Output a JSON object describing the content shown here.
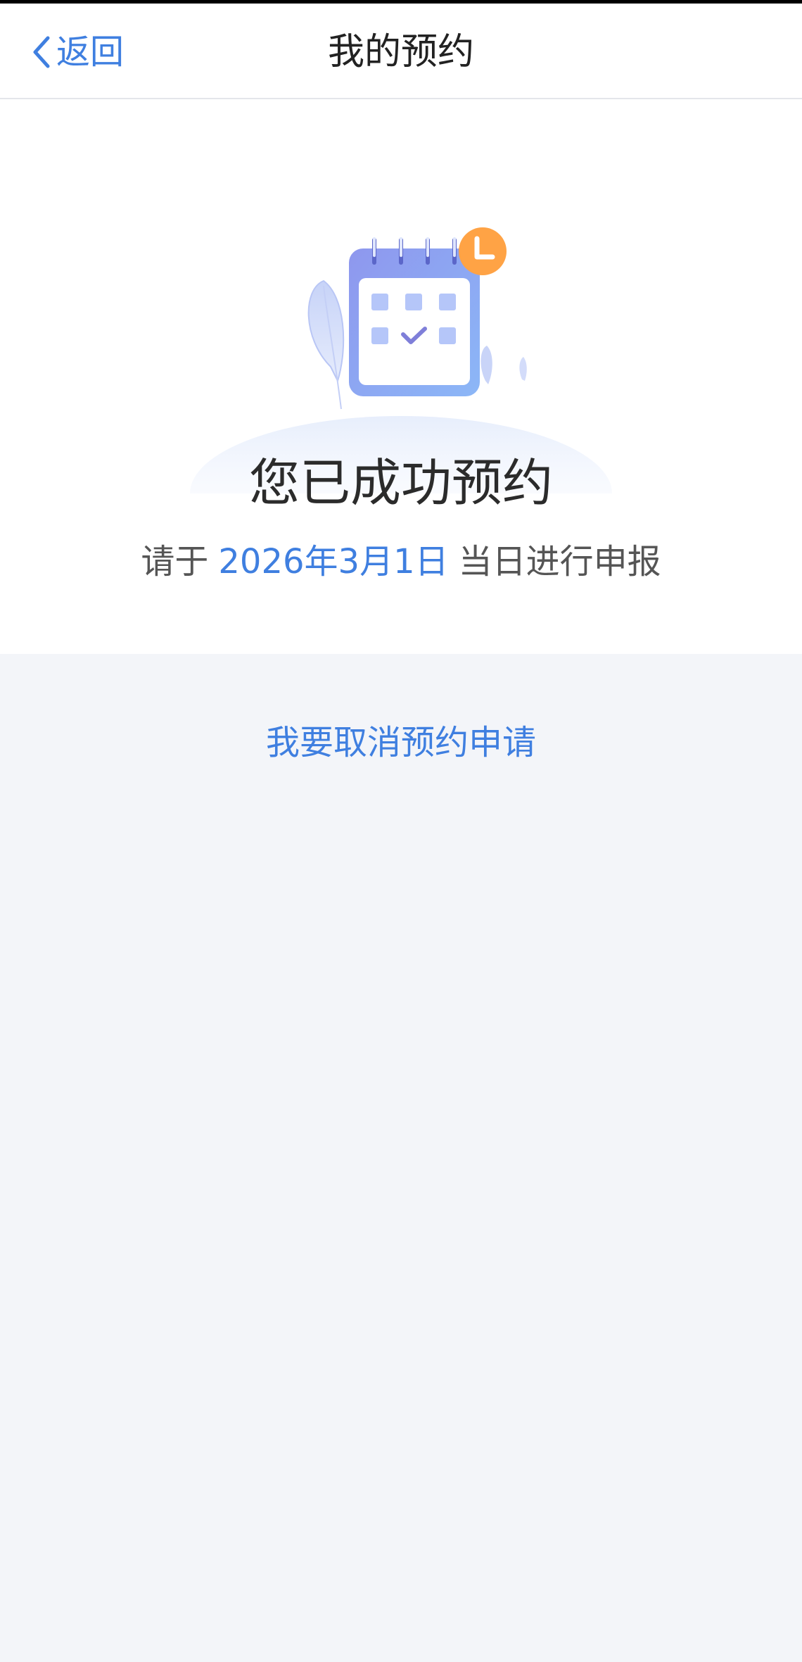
{
  "nav": {
    "back_label": "返回",
    "title": "我的预约"
  },
  "result": {
    "title": "您已成功预约",
    "desc_prefix": "请于",
    "date": "2026年3月1日",
    "desc_suffix": "当日进行申报"
  },
  "actions": {
    "cancel_label": "我要取消预约申请"
  },
  "colors": {
    "accent": "#3f7fe0",
    "page_background": "#f3f5f9",
    "clock_badge": "#ffa345",
    "calendar_header": "#7f8ce8"
  },
  "icons": {
    "back": "chevron-left-icon",
    "illustration": "calendar-booking-illustration",
    "clock_badge": "clock-icon",
    "check": "check-icon"
  }
}
